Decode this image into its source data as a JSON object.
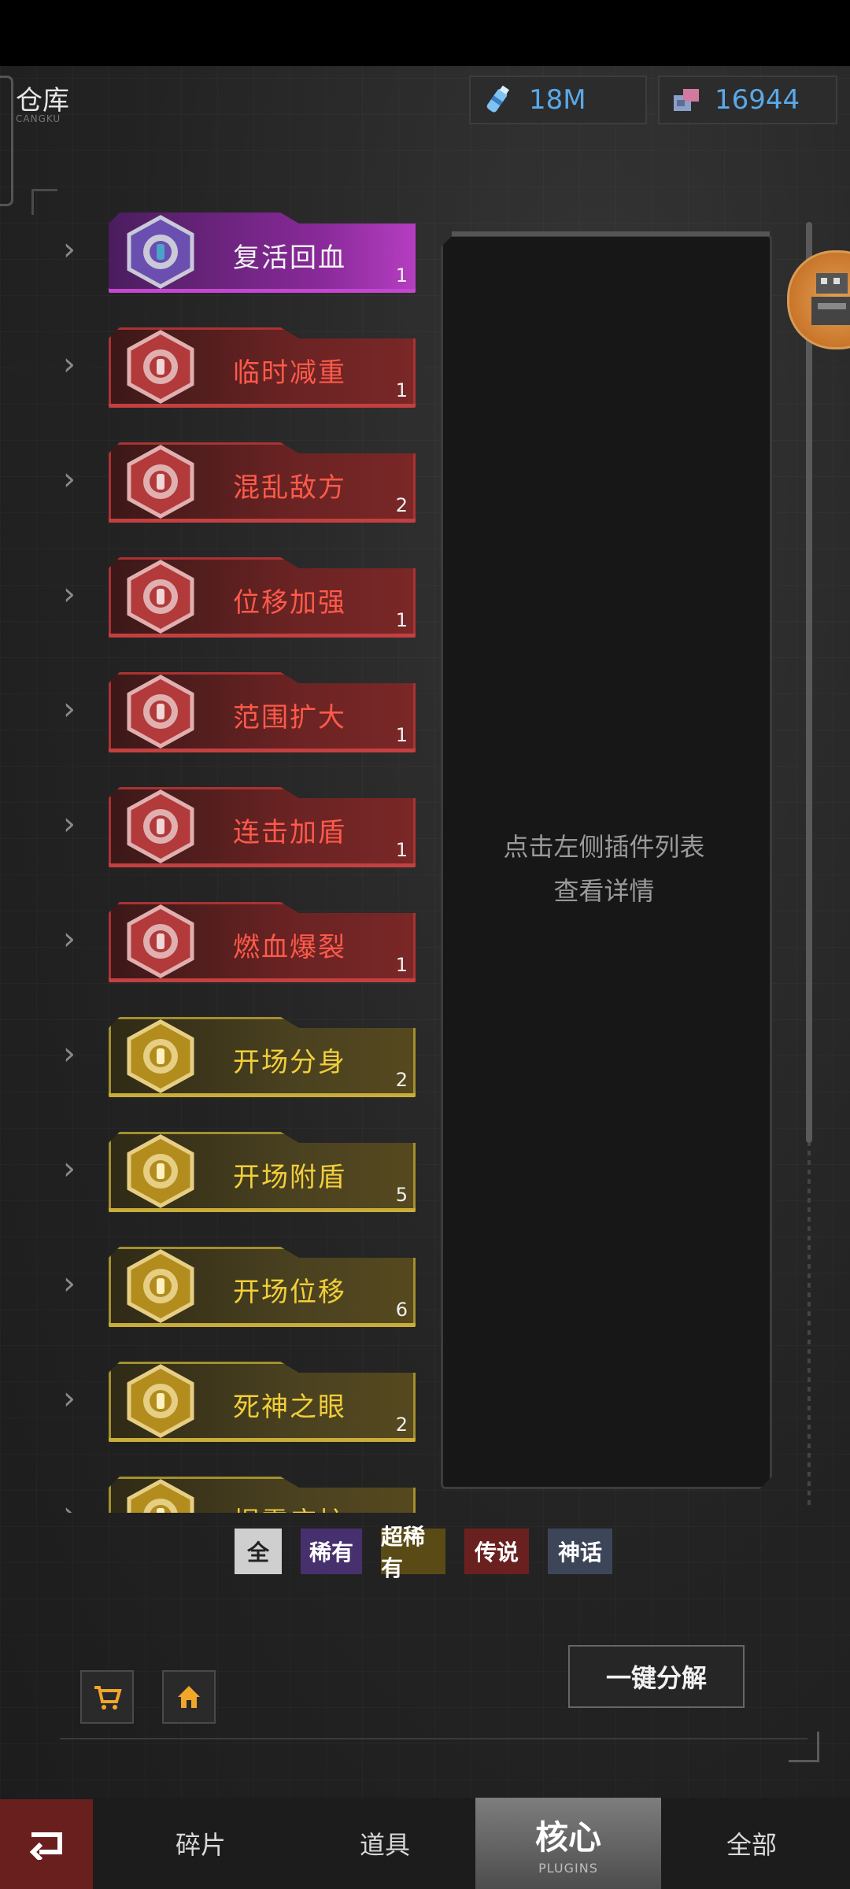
{
  "header": {
    "title": "仓库",
    "subtitle": "CANGKU",
    "currencies": [
      {
        "icon": "energy-bottle-icon",
        "value": "18M"
      },
      {
        "icon": "parts-icon",
        "value": "16944"
      }
    ]
  },
  "items": [
    {
      "name": "复活回血",
      "count": "1",
      "rarity": "purple"
    },
    {
      "name": "临时减重",
      "count": "1",
      "rarity": "red"
    },
    {
      "name": "混乱敌方",
      "count": "2",
      "rarity": "red"
    },
    {
      "name": "位移加强",
      "count": "1",
      "rarity": "red"
    },
    {
      "name": "范围扩大",
      "count": "1",
      "rarity": "red"
    },
    {
      "name": "连击加盾",
      "count": "1",
      "rarity": "red"
    },
    {
      "name": "燃血爆裂",
      "count": "1",
      "rarity": "red"
    },
    {
      "name": "开场分身",
      "count": "2",
      "rarity": "gold"
    },
    {
      "name": "开场附盾",
      "count": "5",
      "rarity": "gold"
    },
    {
      "name": "开场位移",
      "count": "6",
      "rarity": "gold"
    },
    {
      "name": "死神之眼",
      "count": "2",
      "rarity": "gold"
    },
    {
      "name": "揭露应护",
      "count": "",
      "rarity": "gold"
    }
  ],
  "detail": {
    "line1": "点击左侧插件列表",
    "line2": "查看详情"
  },
  "filters": {
    "all": "全",
    "rare": "稀有",
    "super_rare": "超稀有",
    "legendary": "传说",
    "mythic": "神话"
  },
  "actions": {
    "decompose": "一键分解"
  },
  "nav": {
    "fragments": "碎片",
    "props": "道具",
    "core": "核心",
    "core_sub": "PLUGINS",
    "all": "全部"
  },
  "colors": {
    "purple": "#8a2a9a",
    "red": "#c44040",
    "gold": "#c9ad38",
    "accent_blue": "#59a9e8"
  }
}
